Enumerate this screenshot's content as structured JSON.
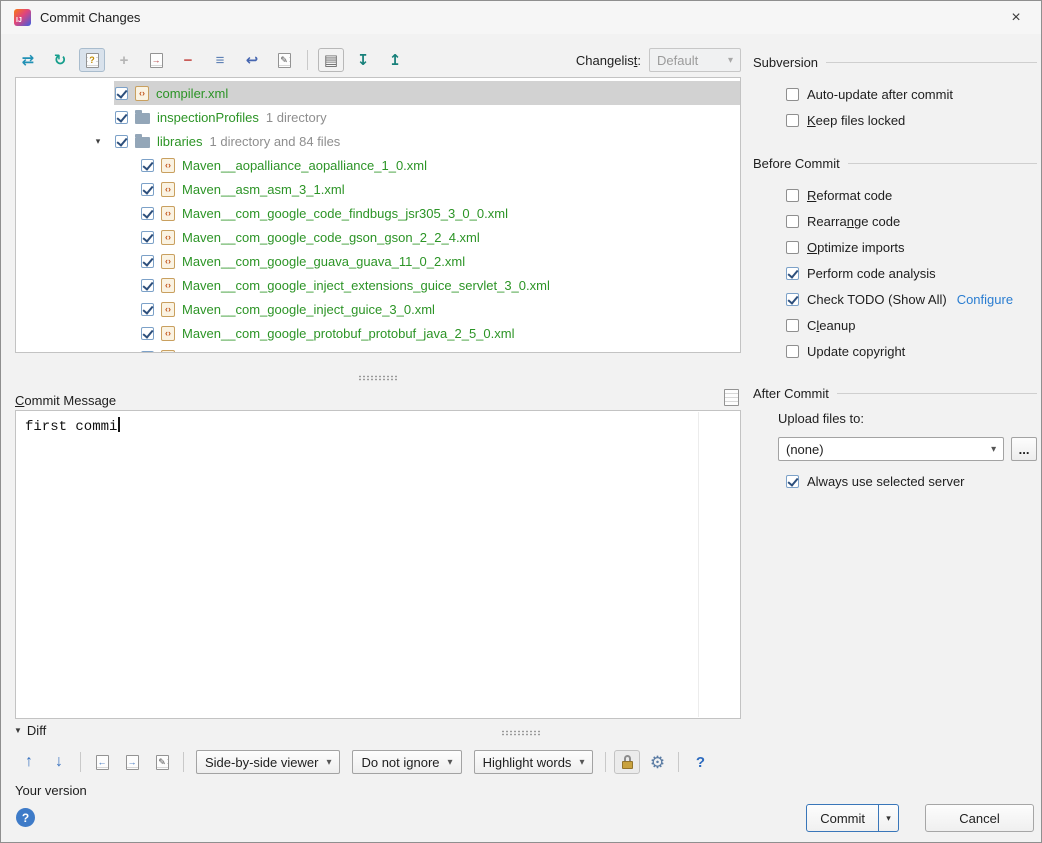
{
  "window": {
    "title": "Commit Changes",
    "logo_text": "IJ"
  },
  "glyphs": {
    "close": "×",
    "chevron_down": "▾",
    "tree_expanded": "▾",
    "diff_triangle": "▼",
    "xml_icon": "‹›"
  },
  "main_toolbar": {
    "changelist_label": {
      "pre": "Changelis",
      "mn": "t",
      "post": ":"
    },
    "changelist_value": "Default",
    "icons": [
      {
        "name": "show-diff-icon",
        "glyph": "⇄",
        "color": "#2191b5",
        "bold": true
      },
      {
        "name": "refresh-icon",
        "glyph": "↻",
        "color": "#169e8c",
        "bold": true
      },
      {
        "name": "show-unversioned-files-icon",
        "shape": "doc",
        "badge": "?",
        "badge_color": "#c08a00",
        "cls": "toggled"
      },
      {
        "name": "add-to-vcs-icon",
        "glyph": "+",
        "color": "#b5b5b5",
        "bold": true
      },
      {
        "name": "move-to-another-changelist-icon",
        "shape": "doc",
        "badge": "→",
        "badge_color": "#b33b3b"
      },
      {
        "name": "delete-icon",
        "glyph": "−",
        "color": "#c75450",
        "bold": true
      },
      {
        "name": "group-by-changelist-icon",
        "glyph": "≡",
        "color": "#5f82b5",
        "bold": true
      },
      {
        "name": "revert-icon",
        "glyph": "↩",
        "color": "#4666b0",
        "bold": true
      },
      {
        "name": "edit-source-icon",
        "shape": "doc",
        "badge": "✎",
        "badge_color": "#4a4a4a"
      },
      {
        "sep": true
      },
      {
        "name": "preview-diff-icon",
        "glyph": "▤",
        "color": "#666666",
        "cls": "framed"
      },
      {
        "name": "expand-all-icon",
        "glyph": "↧",
        "color": "#17807a",
        "bold": true
      },
      {
        "name": "collapse-all-icon",
        "glyph": "↥",
        "color": "#17807a",
        "bold": true
      }
    ]
  },
  "tree": {
    "rows": [
      {
        "type": "file",
        "name": "compiler.xml",
        "indent": 98,
        "selected": true,
        "checked": true
      },
      {
        "type": "dir",
        "name": "inspectionProfiles",
        "suffix": "1 directory",
        "indent": 98,
        "checked": true
      },
      {
        "type": "dir",
        "name": "libraries",
        "suffix": "1 directory and 84 files",
        "indent": 98,
        "chevron": true,
        "checked": true
      },
      {
        "type": "file",
        "name": "Maven__aopalliance_aopalliance_1_0.xml",
        "indent": 124,
        "checked": true
      },
      {
        "type": "file",
        "name": "Maven__asm_asm_3_1.xml",
        "indent": 124,
        "checked": true
      },
      {
        "type": "file",
        "name": "Maven__com_google_code_findbugs_jsr305_3_0_0.xml",
        "indent": 124,
        "checked": true
      },
      {
        "type": "file",
        "name": "Maven__com_google_code_gson_gson_2_2_4.xml",
        "indent": 124,
        "checked": true
      },
      {
        "type": "file",
        "name": "Maven__com_google_guava_guava_11_0_2.xml",
        "indent": 124,
        "checked": true
      },
      {
        "type": "file",
        "name": "Maven__com_google_inject_extensions_guice_servlet_3_0.xml",
        "indent": 124,
        "checked": true
      },
      {
        "type": "file",
        "name": "Maven__com_google_inject_guice_3_0.xml",
        "indent": 124,
        "checked": true
      },
      {
        "type": "file",
        "name": "Maven__com_google_protobuf_protobuf_java_2_5_0.xml",
        "indent": 124,
        "checked": true
      },
      {
        "type": "file",
        "name": "",
        "indent": 124,
        "checked": true,
        "partial": true
      }
    ]
  },
  "right_panel": {
    "sections": [
      {
        "title": "Subversion",
        "items": [
          {
            "label": {
              "pre": "Auto-update after commit"
            },
            "checked": false
          },
          {
            "label": {
              "mn": "K",
              "post": "eep files locked"
            },
            "checked": false
          }
        ]
      },
      {
        "title": "Before Commit",
        "items": [
          {
            "label": {
              "mn": "R",
              "post": "eformat code"
            },
            "checked": false
          },
          {
            "label": {
              "pre": "Rearra",
              "mn": "n",
              "post": "ge code"
            },
            "checked": false
          },
          {
            "label": {
              "mn": "O",
              "post": "ptimize imports"
            },
            "checked": false
          },
          {
            "label": {
              "pre": "Perform code analysis"
            },
            "checked": true
          },
          {
            "label": {
              "pre": "Check TODO (Show All)"
            },
            "checked": true,
            "link": "Configure"
          },
          {
            "label": {
              "pre": "C",
              "mn": "l",
              "post": "eanup"
            },
            "checked": false
          },
          {
            "label": {
              "pre": "Update copyright"
            },
            "checked": false
          }
        ]
      },
      {
        "title": "After Commit",
        "items": []
      }
    ],
    "after_commit": {
      "upload_label": "Upload files to:",
      "upload_value": "(none)",
      "browse_label": "...",
      "always_use": {
        "label": "Always use selected server",
        "checked": true
      }
    }
  },
  "commit_message": {
    "label": {
      "mn": "C",
      "post": "ommit Message"
    },
    "text": "first commi"
  },
  "diff": {
    "header": "Diff",
    "your_version": "Your version",
    "items": [
      {
        "name": "previous-difference-icon",
        "glyph": "↑",
        "color": "#3b74c0",
        "bold": true,
        "size": 16
      },
      {
        "name": "next-difference-icon",
        "glyph": "↓",
        "color": "#3b74c0",
        "bold": true,
        "size": 16
      },
      {
        "sep": true
      },
      {
        "name": "previous-file-icon",
        "shape": "doc",
        "badge": "←",
        "badge_color": "#3b74c0"
      },
      {
        "name": "next-file-icon",
        "shape": "doc",
        "badge": "→",
        "badge_color": "#3b74c0"
      },
      {
        "name": "jump-to-source-icon",
        "shape": "doc",
        "badge": "✎",
        "badge_color": "#4a4a4a"
      },
      {
        "sep": true
      },
      {
        "name": "side-by-side-viewer-dropdown",
        "dropdown": "Side-by-side viewer"
      },
      {
        "name": "ignore-whitespace-dropdown",
        "dropdown": "Do not ignore"
      },
      {
        "name": "highlight-mode-dropdown",
        "dropdown": "Highlight words"
      },
      {
        "sep": true
      },
      {
        "name": "read-only-lock-icon",
        "shape": "lock",
        "cls": "lockframe"
      },
      {
        "name": "diff-settings-gear-icon",
        "glyph": "⚙",
        "color": "#5a7ba3",
        "size": 17
      },
      {
        "sep": true
      },
      {
        "name": "diff-help-icon",
        "glyph": "?",
        "color": "#2d6bbf",
        "bold": true,
        "size": 15
      }
    ]
  },
  "footer": {
    "commit_label": "Commit",
    "cancel_label": "Cancel",
    "help_glyph": "?"
  },
  "colors": {
    "added_file_green": "#2c9426",
    "selection_gray": "#d2d2d2",
    "link_blue": "#2a7dd1",
    "default_button_border": "#3976b9",
    "help_circle_blue": "#3e7bc8"
  }
}
